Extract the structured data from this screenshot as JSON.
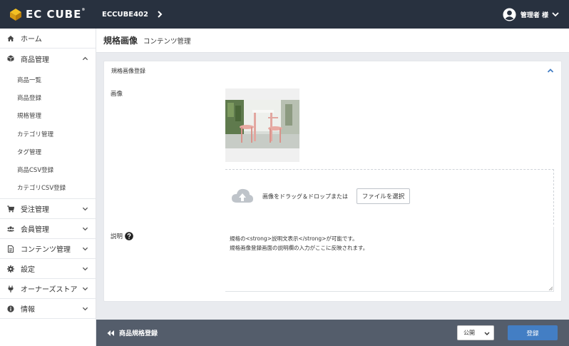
{
  "header": {
    "logo_text": "EC CUBE",
    "logo_mark": "®",
    "shop_name": "ECCUBE402",
    "user_label": "管理者 様"
  },
  "sidebar": {
    "items": [
      {
        "label": "ホーム",
        "icon": "home-icon"
      },
      {
        "label": "商品管理",
        "icon": "cube-icon",
        "expanded": true,
        "children": [
          "商品一覧",
          "商品登録",
          "規格管理",
          "カテゴリ管理",
          "タグ管理",
          "商品CSV登録",
          "カテゴリCSV登録"
        ]
      },
      {
        "label": "受注管理",
        "icon": "cart-icon"
      },
      {
        "label": "会員管理",
        "icon": "users-icon"
      },
      {
        "label": "コンテンツ管理",
        "icon": "file-icon"
      },
      {
        "label": "設定",
        "icon": "gear-icon"
      },
      {
        "label": "オーナーズストア",
        "icon": "plug-icon"
      },
      {
        "label": "情報",
        "icon": "info-icon"
      }
    ]
  },
  "page": {
    "title": "規格画像",
    "subtitle": "コンテンツ管理"
  },
  "card": {
    "title": "規格画像登録",
    "image_label": "画像",
    "drop_text": "画像をドラッグ＆ドロップまたは",
    "file_button": "ファイルを選択",
    "desc_label": "説明",
    "desc_lines": [
      "規格の<strong>説明文表示</strong>が可能です。",
      "規格画像登録画面の説明欄の入力がここに反映されます。"
    ]
  },
  "footer": {
    "back_label": "商品規格登録",
    "status_value": "公開",
    "save_label": "登録"
  },
  "colors": {
    "header_bg": "#28313f",
    "footer_bg": "#545d6b",
    "accent": "#437ec4"
  }
}
